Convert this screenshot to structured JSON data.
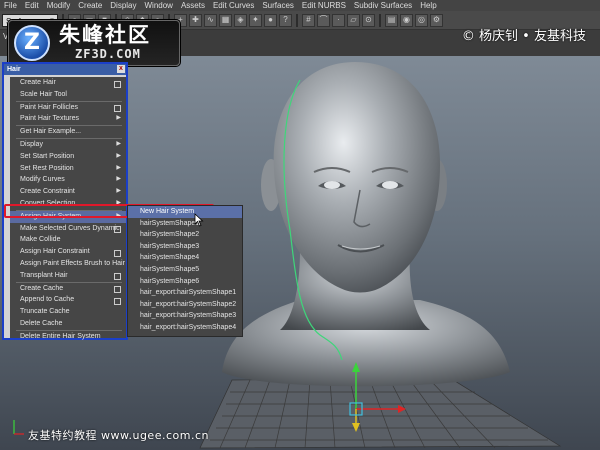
{
  "menubar": [
    "File",
    "Edit",
    "Modify",
    "Create",
    "Display",
    "Window",
    "Assets",
    "Edit Curves",
    "Surfaces",
    "Edit NURBS",
    "Subdiv Surfaces",
    "Help"
  ],
  "statusline": {
    "mode": "Surfaces"
  },
  "shelf": {
    "label": "View"
  },
  "logo": {
    "mark": "Z",
    "cn": "朱峰社区",
    "en": "ZF3D.COM"
  },
  "watermark_top": "© 杨庆钊 • 友基科技",
  "watermark_bottom": "友基特约教程  www.ugee.com.cn",
  "hair_menu": {
    "title": "Hair",
    "close": "x",
    "items": [
      {
        "label": "Create Hair",
        "mark": "box"
      },
      {
        "label": "Scale Hair Tool",
        "mark": ""
      },
      {
        "sep": true
      },
      {
        "label": "Paint Hair Follicles",
        "mark": "box"
      },
      {
        "label": "Paint Hair Textures",
        "mark": "arrow"
      },
      {
        "sep": true
      },
      {
        "label": "Get Hair Example...",
        "mark": ""
      },
      {
        "sep": true
      },
      {
        "label": "Display",
        "mark": "arrow"
      },
      {
        "label": "Set Start Position",
        "mark": "arrow"
      },
      {
        "label": "Set Rest Position",
        "mark": "arrow"
      },
      {
        "label": "Modify Curves",
        "mark": "arrow"
      },
      {
        "label": "Create Constraint",
        "mark": "arrow"
      },
      {
        "label": "Convert Selection",
        "mark": "arrow"
      },
      {
        "sep": true
      },
      {
        "label": "Assign Hair System",
        "mark": "arrow",
        "active": true
      },
      {
        "label": "Make Selected Curves Dynamic",
        "mark": "box"
      },
      {
        "label": "Make Collide",
        "mark": ""
      },
      {
        "label": "Assign Hair Constraint",
        "mark": "box"
      },
      {
        "label": "Assign Paint Effects Brush to Hair",
        "mark": ""
      },
      {
        "label": "Transplant Hair",
        "mark": "box"
      },
      {
        "sep": true
      },
      {
        "label": "Create Cache",
        "mark": "box"
      },
      {
        "label": "Append to Cache",
        "mark": "box"
      },
      {
        "label": "Truncate Cache",
        "mark": ""
      },
      {
        "label": "Delete Cache",
        "mark": ""
      },
      {
        "sep": true
      },
      {
        "label": "Delete Entire Hair System",
        "mark": ""
      }
    ]
  },
  "submenu": {
    "items": [
      {
        "label": "New Hair System",
        "highlight": true
      },
      {
        "label": "hairSystemShape1"
      },
      {
        "label": "hairSystemShape2"
      },
      {
        "label": "hairSystemShape3"
      },
      {
        "label": "hairSystemShape4"
      },
      {
        "label": "hairSystemShape5"
      },
      {
        "label": "hairSystemShape6"
      },
      {
        "label": "hair_export:hairSystemShape1"
      },
      {
        "label": "hair_export:hairSystemShape2"
      },
      {
        "label": "hair_export:hairSystemShape3"
      },
      {
        "label": "hair_export:hairSystemShape4"
      }
    ]
  }
}
